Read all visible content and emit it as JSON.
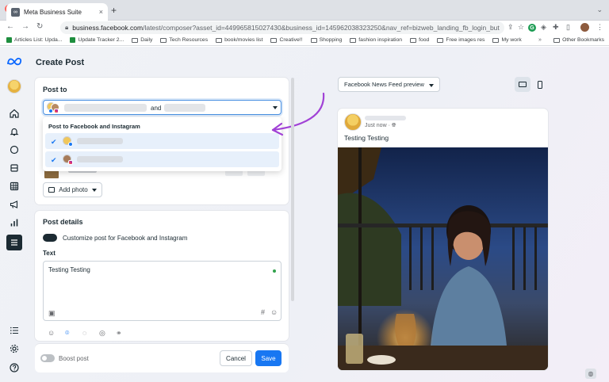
{
  "browser": {
    "tab_title": "Meta Business Suite",
    "tab_close": "×",
    "new_tab": "+",
    "url_host": "business.facebook.com",
    "url_path": "/latest/composer?asset_id=449965815027430&business_id=145962038323250&nav_ref=bizweb_landing_fb_login_button...",
    "bookmarks": [
      {
        "label": "Articles List: Upda...",
        "icon": "green-app-icon"
      },
      {
        "label": "Update Tracker 2...",
        "icon": "green-app-icon"
      },
      {
        "label": "Daily",
        "icon": "folder-icon"
      },
      {
        "label": "Tech Resources",
        "icon": "folder-icon"
      },
      {
        "label": "book/movies list",
        "icon": "folder-icon"
      },
      {
        "label": "Creative!!",
        "icon": "folder-icon"
      },
      {
        "label": "Shopping",
        "icon": "folder-icon"
      },
      {
        "label": "fashion inspiration",
        "icon": "folder-icon"
      },
      {
        "label": "food",
        "icon": "folder-icon"
      },
      {
        "label": "Free images res",
        "icon": "folder-icon"
      },
      {
        "label": "My work",
        "icon": "folder-icon"
      }
    ],
    "bookmarks_more": "»",
    "other_bookmarks": "Other Bookmarks"
  },
  "composer": {
    "page_title": "Create Post",
    "post_to": {
      "heading": "Post to",
      "selected_joiner": "and",
      "dropdown_title": "Post to Facebook and Instagram",
      "options": [
        {
          "checked": true,
          "platform": "facebook"
        },
        {
          "checked": true,
          "platform": "instagram"
        }
      ]
    },
    "add_photo_label": "Add photo",
    "post_details": {
      "heading": "Post details",
      "customize_label": "Customize post for Facebook and Instagram",
      "customize_on": true,
      "text_label": "Text",
      "text_value": "Testing Testing"
    },
    "footer": {
      "boost_label": "Boost post",
      "boost_on": false,
      "cancel_label": "Cancel",
      "save_label": "Save"
    }
  },
  "preview": {
    "placement_label": "Facebook News Feed preview",
    "time_label": "Just now ·",
    "post_text": "Testing Testing"
  },
  "colors": {
    "accent": "#1877f2",
    "annotation_arrow": "#a142d6",
    "selected_row": "#e7f0fb"
  }
}
